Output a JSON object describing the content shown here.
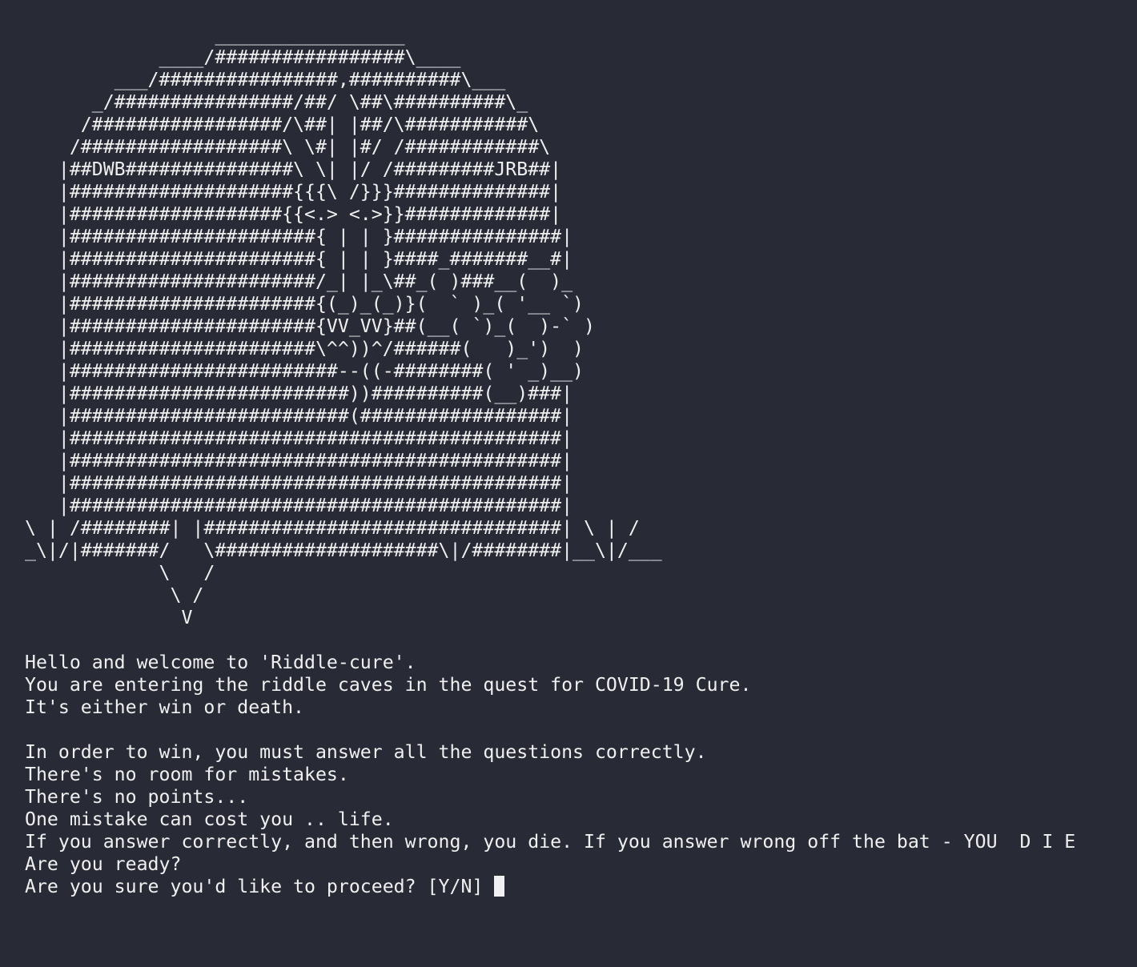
{
  "terminal": {
    "ascii_art": "                 _________________\n            ____/#################\\____\n        ___/################,##########\\___\n      _/################/##/ \\##\\##########\\_\n     /#################/\\##| |##/\\###########\\\n    /##################\\ \\#| |#/ /############\\\n   |##DWB###############\\ \\| |/ /#########JRB##|\n   |####################{{{\\ /}}}##############|\n   |###################{{<.> <.>}}#############|\n   |######################{ | | }###############|\n   |######################{ | | }####_#######__#|\n   |######################/_| |_\\##_( )###__(  )_\n   |######################{(_)_(_)}(  ` )_( '__ `)\n   |######################{VV_VV}##(__( `)_(  )-` )\n   |######################\\^^))^/######(   )_')  )\n   |########################--((-########( ' _)__)\n   |#########################))##########(__)###|\n   |#########################(##################|\n   |############################################|\n   |############################################|\n   |############################################|\n   |############################################|\n\\ | /########| |################################| \\ | /\n_\\|/|#######/   \\####################\\|/########|__\\|/___\n            \\   /\n             \\ /\n              V",
    "lines": [
      "Hello and welcome to 'Riddle-cure'.",
      "You are entering the riddle caves in the quest for COVID-19 Cure.",
      "It's either win or death.",
      "",
      "In order to win, you must answer all the questions correctly.",
      "There's no room for mistakes.",
      "There's no points...",
      "One mistake can cost you .. life.",
      "If you answer correctly, and then wrong, you die. If you answer wrong off the bat - YOU  D I E",
      "Are you ready?"
    ],
    "prompt": "Are you sure you'd like to proceed? [Y/N] ",
    "colors": {
      "background": "#282a36",
      "foreground": "#f0f0f0",
      "cursor": "#f0f0f0"
    }
  }
}
